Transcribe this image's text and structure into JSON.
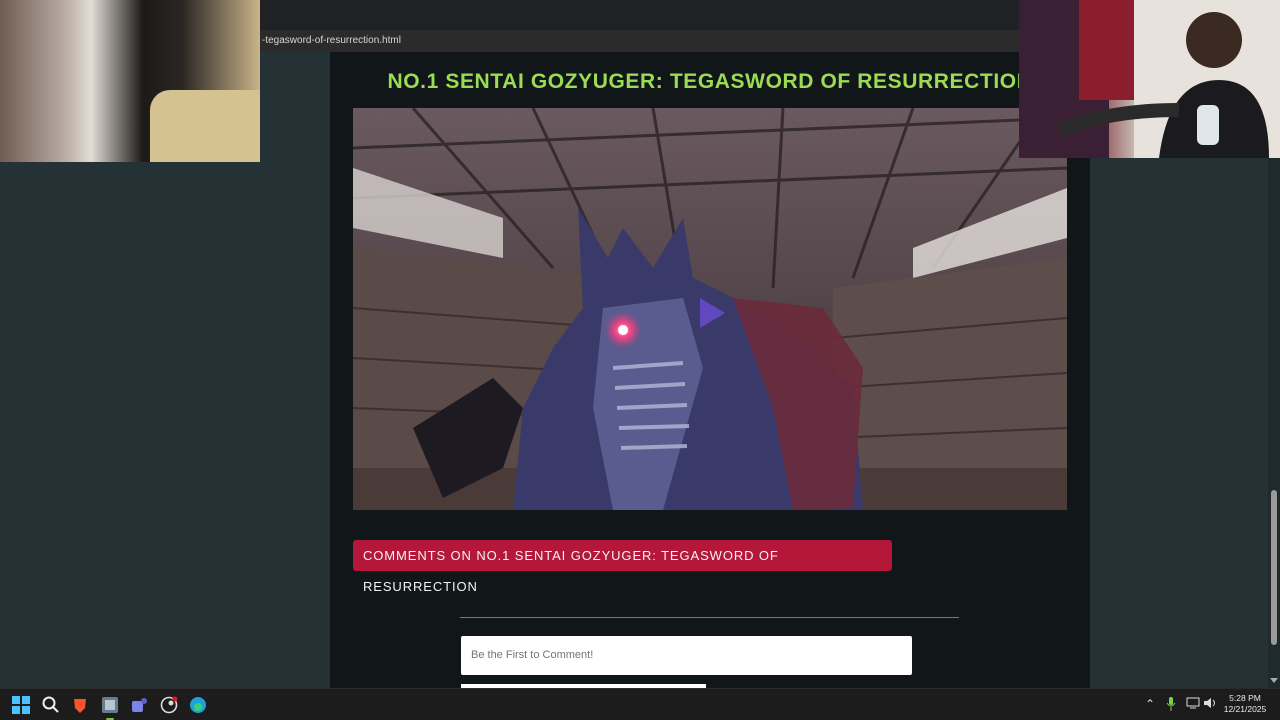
{
  "browser": {
    "url_fragment": "-tegasword-of-resurrection.html"
  },
  "article": {
    "title": "NO.1 SENTAI GOZYUGER: TEGASWORD OF RESURRECTION",
    "comments_heading": "COMMENTS ON NO.1 SENTAI GOZYUGER: TEGASWORD OF RESURRECTION",
    "comment_placeholder": "Be the First to Comment!"
  },
  "colors": {
    "title_green": "#9cdb54",
    "banner_red": "#b5173a",
    "page_bg": "#111619",
    "outer_bg": "#243235"
  },
  "taskbar": {
    "icons": [
      "windows-start-icon",
      "search-icon",
      "brave-browser-icon",
      "app-icon",
      "teams-icon",
      "steam-icon",
      "edge-icon"
    ],
    "tray_icons": [
      "chevron-up-icon",
      "microphone-icon",
      "network-icon",
      "volume-icon"
    ],
    "time": "5:28 PM",
    "date": "12/21/2025"
  }
}
